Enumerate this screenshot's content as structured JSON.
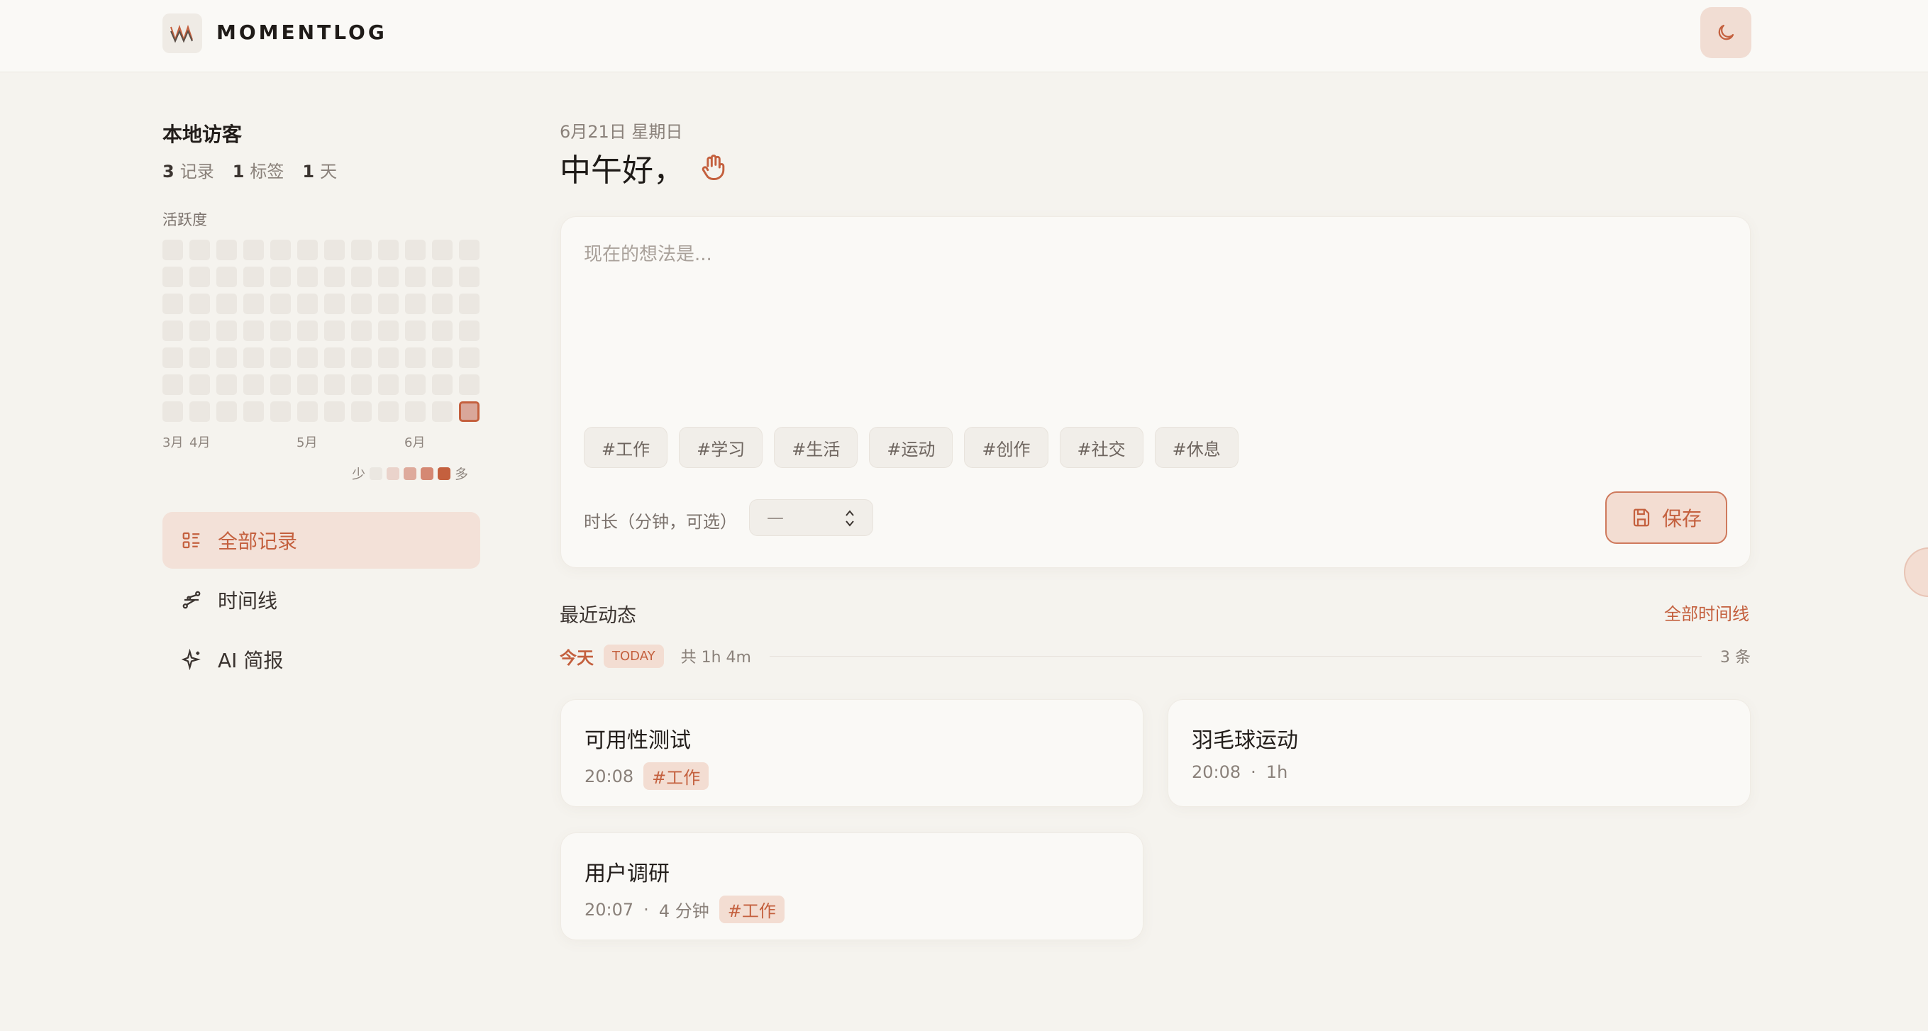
{
  "app": {
    "brand": "MOMENTLOG"
  },
  "sidebar": {
    "user_name": "本地访客",
    "stats": [
      {
        "value": "3",
        "label": "记录"
      },
      {
        "value": "1",
        "label": "标签"
      },
      {
        "value": "1",
        "label": "天"
      }
    ],
    "activity_label": "活跃度",
    "months": [
      "3月",
      "4月",
      "5月",
      "6月"
    ],
    "legend_less": "少",
    "legend_more": "多",
    "legend_colors": [
      "#ebe7e1",
      "#ead3cb",
      "#deaa9c",
      "#d58873",
      "#c4603e"
    ],
    "nav": [
      {
        "label": "全部记录",
        "icon": "list-icon",
        "active": true
      },
      {
        "label": "时间线",
        "icon": "timeline-icon",
        "active": false
      },
      {
        "label": "AI 简报",
        "icon": "sparkle-icon",
        "active": false
      }
    ]
  },
  "main": {
    "date": "6月21日 星期日",
    "greeting": "中午好，",
    "composer": {
      "placeholder": "现在的想法是...",
      "tags": [
        "#工作",
        "#学习",
        "#生活",
        "#运动",
        "#创作",
        "#社交",
        "#休息"
      ],
      "duration_label": "时长（分钟，可选）",
      "duration_placeholder": "—",
      "save_label": "保存"
    },
    "recent": {
      "title": "最近动态",
      "all_link": "全部时间线",
      "day_label": "今天",
      "day_badge": "TODAY",
      "day_total": "共 1h 4m",
      "day_count": "3 条",
      "cards": [
        {
          "title": "可用性测试",
          "time": "20:08",
          "duration": "",
          "tag": "#工作"
        },
        {
          "title": "羽毛球运动",
          "time": "20:08",
          "duration": "1h",
          "tag": ""
        },
        {
          "title": "用户调研",
          "time": "20:07",
          "duration": "4 分钟",
          "tag": "#工作"
        }
      ]
    }
  },
  "colors": {
    "accent": "#c4603e",
    "accent_soft": "#f3ddd2",
    "background": "#f5f3ee"
  }
}
